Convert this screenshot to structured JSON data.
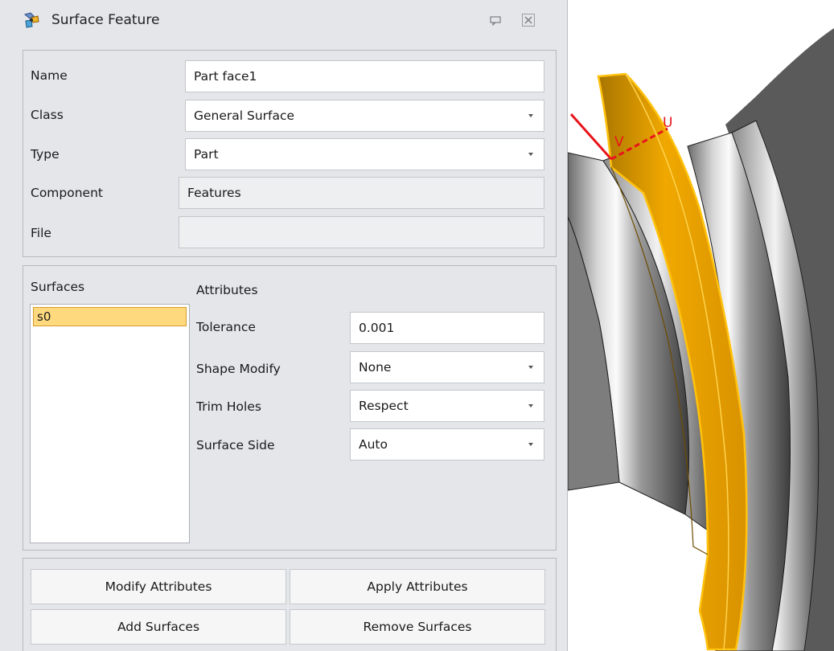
{
  "window": {
    "title": "Surface Feature",
    "icons": [
      "app-icon",
      "pin-icon",
      "close-icon"
    ]
  },
  "general": {
    "name_label": "Name",
    "name_value": "Part face1",
    "class_label": "Class",
    "class_value": "General Surface",
    "type_label": "Type",
    "type_value": "Part",
    "component_label": "Component",
    "component_value": "Features",
    "file_label": "File",
    "file_value": ""
  },
  "surfaces": {
    "label": "Surfaces",
    "items": [
      "s0"
    ],
    "selected": "s0"
  },
  "attributes": {
    "heading": "Attributes",
    "tolerance_label": "Tolerance",
    "tolerance_value": "0.001",
    "shape_modify_label": "Shape Modify",
    "shape_modify_value": "None",
    "trim_holes_label": "Trim Holes",
    "trim_holes_value": "Respect",
    "surface_side_label": "Surface Side",
    "surface_side_value": "Auto"
  },
  "buttons": {
    "modify": "Modify Attributes",
    "apply": "Apply Attributes",
    "add": "Add Surfaces",
    "remove": "Remove Surfaces"
  },
  "viewport": {
    "axis_labels": [
      "V",
      "U"
    ],
    "colors": {
      "highlight": "#f2a900",
      "highlight_edge": "#ffc20e",
      "axis": "#e8141b",
      "metal_dark": "#3c3c3c",
      "metal_light": "#f4f4f4"
    }
  }
}
